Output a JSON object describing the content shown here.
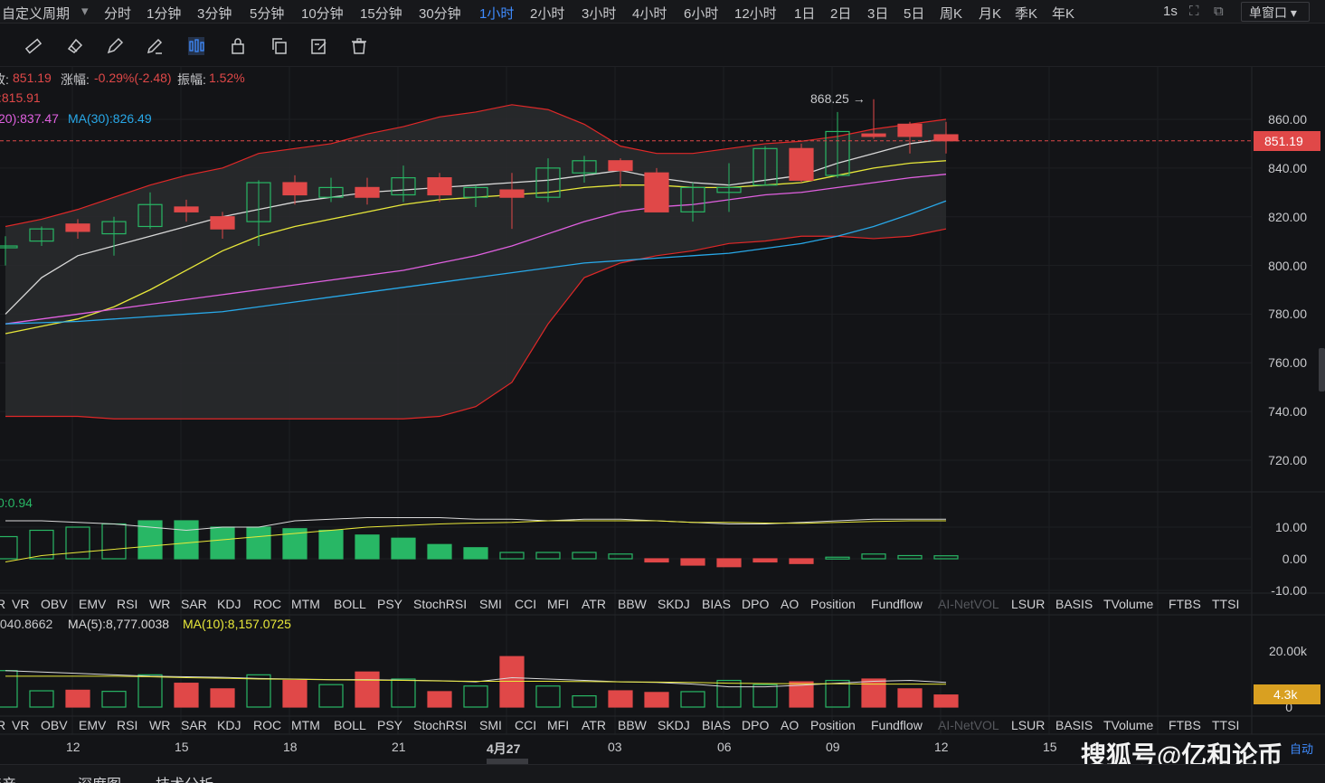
{
  "periods": [
    {
      "label": "自定义周期",
      "active": false
    },
    {
      "label": "分时",
      "active": false
    },
    {
      "label": "1分钟",
      "active": false
    },
    {
      "label": "3分钟",
      "active": false
    },
    {
      "label": "5分钟",
      "active": false
    },
    {
      "label": "10分钟",
      "active": false
    },
    {
      "label": "15分钟",
      "active": false
    },
    {
      "label": "30分钟",
      "active": false
    },
    {
      "label": "1小时",
      "active": true
    },
    {
      "label": "2小时",
      "active": false
    },
    {
      "label": "3小时",
      "active": false
    },
    {
      "label": "4小时",
      "active": false
    },
    {
      "label": "6小时",
      "active": false
    },
    {
      "label": "12小时",
      "active": false
    },
    {
      "label": "1日",
      "active": false
    },
    {
      "label": "2日",
      "active": false
    },
    {
      "label": "3日",
      "active": false
    },
    {
      "label": "5日",
      "active": false
    },
    {
      "label": "周K",
      "active": false
    },
    {
      "label": "月K",
      "active": false
    },
    {
      "label": "季K",
      "active": false
    },
    {
      "label": "年K",
      "active": false
    }
  ],
  "top_right": {
    "interval": "1s",
    "window": "单窗口"
  },
  "toolbar_icons": [
    "ruler-icon",
    "eraser-icon",
    "pencil-icon",
    "brush-icon",
    "candlestick-icon",
    "lock-icon",
    "copy-icon",
    "edit-icon",
    "trash-icon"
  ],
  "info": {
    "close_label": "收:",
    "close": "851.19",
    "change_label": "涨幅:",
    "change": "-0.29%(-2.48)",
    "amp_label": "振幅:",
    "amp": "1.52%",
    "line2": ":815.91",
    "ma20": "20):837.47",
    "ma30": "MA(30):826.49"
  },
  "osc_label": "0:0.94",
  "vol_info": {
    "val": ",040.8662",
    "ma5": "MA(5):8,777.0038",
    "ma10": "MA(10):8,157.0725"
  },
  "price_axis": [
    "860.00",
    "840.00",
    "820.00",
    "800.00",
    "780.00",
    "760.00",
    "740.00",
    "720.00"
  ],
  "current_price": "851.19",
  "high_marker": "868.25 →",
  "osc_axis": [
    "10.00",
    "0.00",
    "-10.00"
  ],
  "vol_axis": [
    "20.00k",
    "0"
  ],
  "current_volume": "4.3k",
  "indicator_tabs": [
    "R",
    "VR",
    "OBV",
    "EMV",
    "RSI",
    "WR",
    "SAR",
    "KDJ",
    "ROC",
    "MTM",
    "BOLL",
    "PSY",
    "StochRSI",
    "SMI",
    "CCI",
    "MFI",
    "ATR",
    "BBW",
    "SKDJ",
    "BIAS",
    "DPO",
    "AO",
    "Position",
    "Fundflow",
    "AI-NetVOL",
    "LSUR",
    "BASIS",
    "TVolume",
    "FTBS",
    "TTSI"
  ],
  "x_labels": [
    "12",
    "15",
    "18",
    "21",
    "4月27",
    "03",
    "06",
    "09",
    "12",
    "15"
  ],
  "auto_label": "自动",
  "watermark": "搜狐号@亿和论币",
  "bottom_tabs": [
    "资产",
    "深度图",
    "技术分析"
  ],
  "colors": {
    "up": "#28b765",
    "down": "#e04848",
    "active": "#3f8cff",
    "ma5": "#d8d8d8",
    "ma10": "#e8e83a",
    "ma20": "#e060e0",
    "ma30": "#28a8e8",
    "boll": "#e02828"
  },
  "chart_data": {
    "type": "candlestick",
    "candles": [
      {
        "o": 808,
        "c": 808,
        "h": 812,
        "l": 800
      },
      {
        "o": 810,
        "c": 815,
        "h": 816,
        "l": 808
      },
      {
        "o": 817,
        "c": 814,
        "h": 819,
        "l": 811
      },
      {
        "o": 813,
        "c": 818,
        "h": 820,
        "l": 804
      },
      {
        "o": 816,
        "c": 825,
        "h": 830,
        "l": 815
      },
      {
        "o": 824,
        "c": 822,
        "h": 827,
        "l": 818
      },
      {
        "o": 820,
        "c": 815,
        "h": 822,
        "l": 811
      },
      {
        "o": 818,
        "c": 834,
        "h": 835,
        "l": 808
      },
      {
        "o": 834,
        "c": 829,
        "h": 837,
        "l": 825
      },
      {
        "o": 828,
        "c": 832,
        "h": 836,
        "l": 826
      },
      {
        "o": 832,
        "c": 828,
        "h": 836,
        "l": 825
      },
      {
        "o": 829,
        "c": 836,
        "h": 841,
        "l": 826
      },
      {
        "o": 836,
        "c": 829,
        "h": 838,
        "l": 826
      },
      {
        "o": 828,
        "c": 832,
        "h": 833,
        "l": 824
      },
      {
        "o": 831,
        "c": 828,
        "h": 838,
        "l": 815
      },
      {
        "o": 828,
        "c": 840,
        "h": 844,
        "l": 826
      },
      {
        "o": 838,
        "c": 843,
        "h": 845,
        "l": 834
      },
      {
        "o": 843,
        "c": 839,
        "h": 844,
        "l": 832
      },
      {
        "o": 838,
        "c": 822,
        "h": 840,
        "l": 822
      },
      {
        "o": 822,
        "c": 832,
        "h": 834,
        "l": 818
      },
      {
        "o": 830,
        "c": 832,
        "h": 842,
        "l": 822
      },
      {
        "o": 833,
        "c": 848,
        "h": 849,
        "l": 833
      },
      {
        "o": 848,
        "c": 835,
        "h": 850,
        "l": 834
      },
      {
        "o": 837,
        "c": 855,
        "h": 863,
        "l": 836
      },
      {
        "o": 854,
        "c": 853,
        "h": 868.25,
        "l": 852
      },
      {
        "o": 858,
        "c": 853,
        "h": 859,
        "l": 846
      },
      {
        "o": 853.67,
        "c": 851.19,
        "h": 859,
        "l": 846
      }
    ],
    "ma_lines": {
      "ma5": [
        780,
        795,
        804,
        808,
        812,
        816,
        820,
        823,
        826,
        828,
        830,
        831,
        832,
        833,
        834,
        835,
        837,
        839,
        836,
        834,
        833,
        835,
        837,
        842,
        846,
        850,
        852
      ],
      "ma10": [
        772,
        775,
        778,
        783,
        790,
        798,
        806,
        812,
        816,
        819,
        822,
        825,
        827,
        828,
        829,
        830,
        832,
        833,
        833,
        832,
        832,
        833,
        834,
        837,
        840,
        842,
        843
      ],
      "ma20": [
        776,
        778,
        780,
        782,
        784,
        786,
        788,
        790,
        792,
        794,
        796,
        798,
        801,
        804,
        808,
        813,
        818,
        822,
        824,
        825,
        827,
        829,
        830,
        832,
        834,
        836,
        837.47
      ],
      "ma30": [
        776,
        776.5,
        777,
        778,
        779,
        780,
        781,
        783,
        785,
        787,
        789,
        791,
        793,
        795,
        797,
        799,
        801,
        802,
        803,
        804,
        805,
        807,
        809,
        812,
        816,
        821,
        826.49
      ]
    },
    "boll": {
      "upper": [
        816,
        819,
        823,
        828,
        833,
        837,
        840,
        846,
        848,
        850,
        854,
        857,
        861,
        863,
        866,
        864,
        858,
        849,
        846,
        846,
        848,
        850,
        851,
        853,
        856,
        858,
        860
      ],
      "lower": [
        738,
        738,
        738,
        737,
        737,
        737,
        737,
        737,
        737,
        737,
        737,
        737,
        738,
        742,
        752,
        776,
        795,
        801,
        804,
        806,
        809,
        810,
        812,
        812,
        811,
        812,
        815
      ]
    },
    "oscillator": [
      {
        "v": 7,
        "w": 12,
        "y": -1,
        "dir": "up"
      },
      {
        "v": 9,
        "w": 12,
        "y": 1,
        "dir": "up"
      },
      {
        "v": 10,
        "w": 11.5,
        "y": 2,
        "dir": "up"
      },
      {
        "v": 11,
        "w": 11,
        "y": 3,
        "dir": "up"
      },
      {
        "v": 12,
        "w": 10,
        "y": 4,
        "dir": "up"
      },
      {
        "v": 12,
        "w": 9,
        "y": 5,
        "dir": "up"
      },
      {
        "v": 10,
        "w": 10,
        "y": 6,
        "dir": "up"
      },
      {
        "v": 10,
        "w": 10,
        "y": 7,
        "dir": "up"
      },
      {
        "v": 9.5,
        "w": 12,
        "y": 8,
        "dir": "up"
      },
      {
        "v": 9,
        "w": 12.5,
        "y": 9,
        "dir": "up"
      },
      {
        "v": 7.5,
        "w": 13,
        "y": 10,
        "dir": "up"
      },
      {
        "v": 6.5,
        "w": 13,
        "y": 10.5,
        "dir": "up"
      },
      {
        "v": 4.5,
        "w": 13,
        "y": 11,
        "dir": "up"
      },
      {
        "v": 3.5,
        "w": 12.5,
        "y": 11.3,
        "dir": "up"
      },
      {
        "v": 2,
        "w": 12.5,
        "y": 11.5,
        "dir": "up"
      },
      {
        "v": 2,
        "w": 12,
        "y": 12,
        "dir": "up"
      },
      {
        "v": 2,
        "w": 12.5,
        "y": 12,
        "dir": "up"
      },
      {
        "v": 1.5,
        "w": 12.5,
        "y": 12,
        "dir": "up"
      },
      {
        "v": -1,
        "w": 12,
        "y": 12,
        "dir": "down"
      },
      {
        "v": -2,
        "w": 11.5,
        "y": 11.5,
        "dir": "down"
      },
      {
        "v": -2.5,
        "w": 11,
        "y": 11.5,
        "dir": "down"
      },
      {
        "v": -1,
        "w": 11,
        "y": 11.3,
        "dir": "down"
      },
      {
        "v": -1.5,
        "w": 11.5,
        "y": 11.2,
        "dir": "down"
      },
      {
        "v": 0.5,
        "w": 12,
        "y": 11.5,
        "dir": "up"
      },
      {
        "v": 1.5,
        "w": 12.5,
        "y": 11.8,
        "dir": "up"
      },
      {
        "v": 1,
        "w": 12.5,
        "y": 12,
        "dir": "up"
      },
      {
        "v": 0.94,
        "w": 12.5,
        "y": 12,
        "dir": "up"
      }
    ],
    "volume": [
      {
        "v": 13000,
        "dir": "up"
      },
      {
        "v": 5800,
        "dir": "up"
      },
      {
        "v": 6000,
        "dir": "down"
      },
      {
        "v": 5600,
        "dir": "up"
      },
      {
        "v": 11500,
        "dir": "up"
      },
      {
        "v": 8500,
        "dir": "down"
      },
      {
        "v": 6500,
        "dir": "down"
      },
      {
        "v": 11500,
        "dir": "up"
      },
      {
        "v": 9500,
        "dir": "down"
      },
      {
        "v": 8000,
        "dir": "up"
      },
      {
        "v": 12500,
        "dir": "down"
      },
      {
        "v": 10000,
        "dir": "up"
      },
      {
        "v": 5500,
        "dir": "down"
      },
      {
        "v": 7500,
        "dir": "up"
      },
      {
        "v": 18000,
        "dir": "down"
      },
      {
        "v": 7500,
        "dir": "up"
      },
      {
        "v": 4000,
        "dir": "up"
      },
      {
        "v": 5800,
        "dir": "down"
      },
      {
        "v": 5200,
        "dir": "down"
      },
      {
        "v": 5500,
        "dir": "up"
      },
      {
        "v": 9500,
        "dir": "up"
      },
      {
        "v": 8000,
        "dir": "up"
      },
      {
        "v": 9000,
        "dir": "down"
      },
      {
        "v": 9500,
        "dir": "up"
      },
      {
        "v": 10000,
        "dir": "down"
      },
      {
        "v": 6500,
        "dir": "down"
      },
      {
        "v": 4300,
        "dir": "down"
      }
    ],
    "vol_ma5": [
      13000,
      12500,
      12000,
      11500,
      11000,
      10800,
      10600,
      10200,
      10000,
      9800,
      9800,
      9600,
      9400,
      9000,
      10500,
      10000,
      9500,
      9000,
      8800,
      8200,
      7200,
      7200,
      7800,
      8500,
      9200,
      9500,
      8777
    ],
    "vol_ma10": [
      11000,
      11000,
      11000,
      11000,
      10800,
      10500,
      10300,
      10000,
      9900,
      9700,
      9600,
      9500,
      9300,
      9200,
      9200,
      9200,
      9100,
      9000,
      8900,
      8800,
      8500,
      8400,
      8300,
      8300,
      8200,
      8200,
      8157
    ]
  }
}
